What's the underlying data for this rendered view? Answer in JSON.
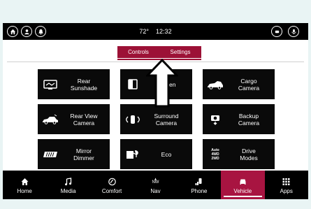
{
  "status_bar": {
    "temperature": "72°",
    "time": "12:32",
    "left_buttons": [
      "home-icon",
      "profile-icon",
      "bell-icon"
    ],
    "right_buttons": [
      "device-icon",
      "microphone-icon"
    ]
  },
  "tabs": [
    {
      "label": "Controls",
      "active": true
    },
    {
      "label": "Settings",
      "active": false
    }
  ],
  "tiles": [
    {
      "label": "Rear\nSunshade",
      "icon": "sunshade-icon"
    },
    {
      "label": "Screen",
      "icon": "screen-off-icon"
    },
    {
      "label": "Cargo\nCamera",
      "icon": "cargo-camera-icon"
    },
    {
      "label": "Rear View\nCamera",
      "icon": "rear-view-camera-icon"
    },
    {
      "label": "Surround\nCamera",
      "icon": "surround-camera-icon"
    },
    {
      "label": "Backup\nCamera",
      "icon": "backup-camera-icon"
    },
    {
      "label": "Mirror\nDimmer",
      "icon": "mirror-dimmer-icon"
    },
    {
      "label": "Eco",
      "icon": "eco-icon"
    },
    {
      "label": "Drive\nModes",
      "icon": "drive-modes-icon"
    }
  ],
  "drive_modes_icon_text": {
    "line1": "Auto",
    "line2": "4WD",
    "line3": "2WD"
  },
  "nav": [
    {
      "label": "Home",
      "icon": "home-icon",
      "active": false
    },
    {
      "label": "Media",
      "icon": "music-note-icon",
      "active": false
    },
    {
      "label": "Comfort",
      "icon": "comfort-icon",
      "active": false
    },
    {
      "label": "Nav",
      "icon": "compass-icon",
      "compass": "NW",
      "active": false
    },
    {
      "label": "Phone",
      "icon": "phone-icon",
      "active": false
    },
    {
      "label": "Vehicle",
      "icon": "vehicle-icon",
      "active": true
    },
    {
      "label": "Apps",
      "icon": "apps-grid-icon",
      "active": false
    }
  ],
  "colors": {
    "accent": "#9c1136",
    "tile": "#0a0a0a",
    "background": "#e9f4f4"
  }
}
